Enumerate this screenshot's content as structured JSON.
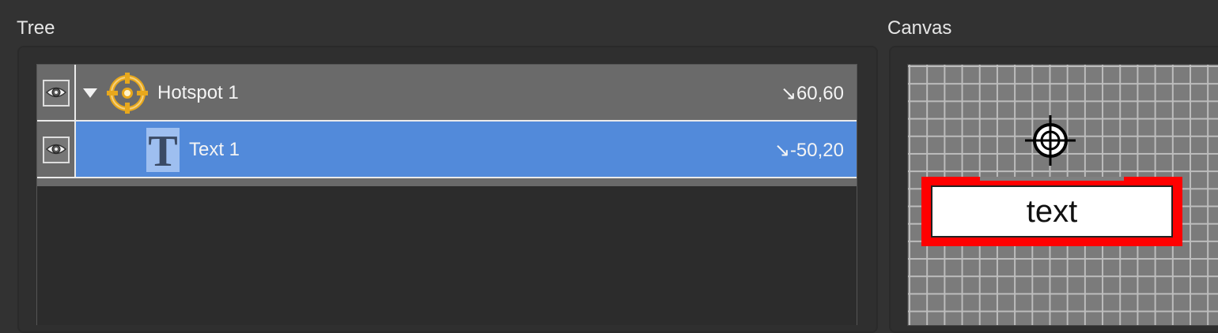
{
  "panels": {
    "tree_title": "Tree",
    "canvas_title": "Canvas"
  },
  "tree": {
    "rows": [
      {
        "label": "Hotspot 1",
        "coord": "↘60,60",
        "icon": "hotspot-target-icon",
        "expanded": true,
        "visible": true,
        "selected": false
      },
      {
        "label": "Text 1",
        "coord": "↘-50,20",
        "icon": "text-T-icon",
        "icon_glyph": "T",
        "visible": true,
        "selected": true
      }
    ]
  },
  "canvas": {
    "text_element": "text",
    "crosshair_icon": "crosshair-icon"
  },
  "colors": {
    "background": "#323232",
    "row_bg": "#6a6a6a",
    "selection": "#528ada",
    "hotspot_icon": "#e8a81c",
    "selection_outline": "#ff0000"
  }
}
